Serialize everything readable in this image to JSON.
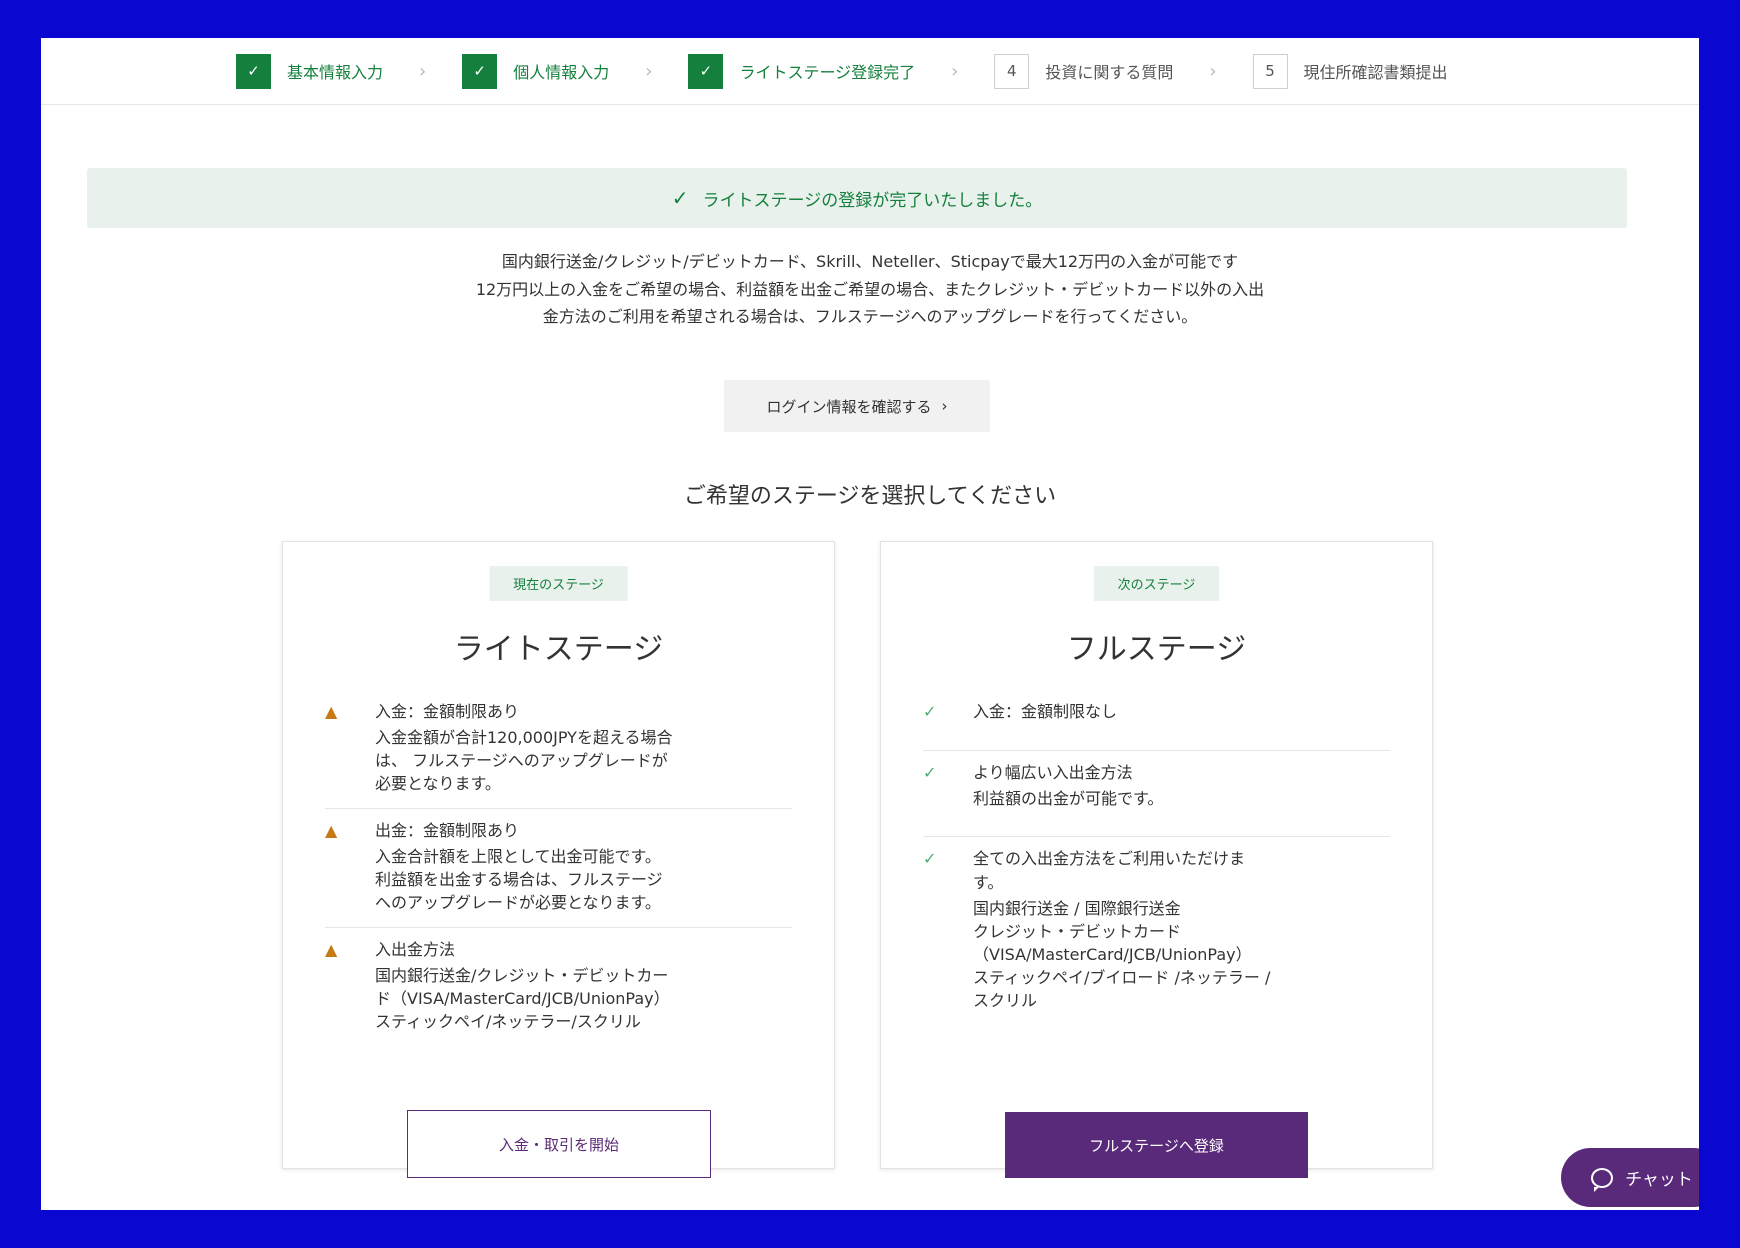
{
  "steps": [
    {
      "num": "✓",
      "label": "基本情報入力",
      "state": "done"
    },
    {
      "num": "✓",
      "label": "個人情報入力",
      "state": "done"
    },
    {
      "num": "✓",
      "label": "ライトステージ登録完了",
      "state": "done"
    },
    {
      "num": "4",
      "label": "投資に関する質問",
      "state": "todo"
    },
    {
      "num": "5",
      "label": "現住所確認書類提出",
      "state": "todo"
    }
  ],
  "step_separator": "›",
  "banner": {
    "icon": "✓",
    "text": "ライトステージの登録が完了いたしました。"
  },
  "notice": [
    "国内銀行送金/クレジット/デビットカード、Skrill、Neteller、Sticpayで最大12万円の入金が可能です",
    "12万円以上の入金をご希望の場合、利益額を出金ご希望の場合、またクレジット・デビットカード以外の入出",
    "金方法のご利用を希望される場合は、フルステージへのアップグレードを行ってください。"
  ],
  "login_button": {
    "label": "ログイン情報を確認する",
    "chevron": "›"
  },
  "select_title": "ご希望のステージを選択してください",
  "cards": {
    "light": {
      "badge": "現在のステージ",
      "title": "ライトステージ",
      "features": [
        {
          "icon": "▲",
          "title": "入金：金額制限あり",
          "desc": [
            "入金金額が合計120,000JPYを超える場合",
            "は、 フルステージへのアップグレードが",
            "必要となります。"
          ]
        },
        {
          "icon": "▲",
          "title": "出金：金額制限あり",
          "desc": [
            "入金合計額を上限として出金可能です。",
            "利益額を出金する場合は、フルステージ",
            "へのアップグレードが必要となります。"
          ]
        },
        {
          "icon": "▲",
          "title": "入出金方法",
          "desc": [
            "国内銀行送金/クレジット・デビットカー",
            "ド（VISA/MasterCard/JCB/UnionPay）",
            "スティックペイ/ネッテラー/スクリル"
          ]
        }
      ],
      "button": "入金・取引を開始"
    },
    "full": {
      "badge": "次のステージ",
      "title": "フルステージ",
      "features": [
        {
          "icon": "✓",
          "title": "入金：金額制限なし",
          "desc": []
        },
        {
          "icon": "✓",
          "title": "より幅広い入出金方法",
          "desc": [
            "利益額の出金が可能です。"
          ]
        },
        {
          "icon": "✓",
          "title": "全ての入出金方法をご利用いただけま\nす。",
          "desc": [
            "国内銀行送金 / 国際銀行送金",
            "クレジット・デビットカード",
            "（VISA/MasterCard/JCB/UnionPay）",
            "スティックペイ/ブイロード /ネッテラー /",
            "スクリル"
          ]
        }
      ],
      "button": "フルステージへ登録"
    }
  },
  "chat_button": "チャット",
  "colors": {
    "green": "#15803d",
    "purple": "#5a2a7a",
    "warning": "#c57a13",
    "frame": "#0a08d0"
  }
}
